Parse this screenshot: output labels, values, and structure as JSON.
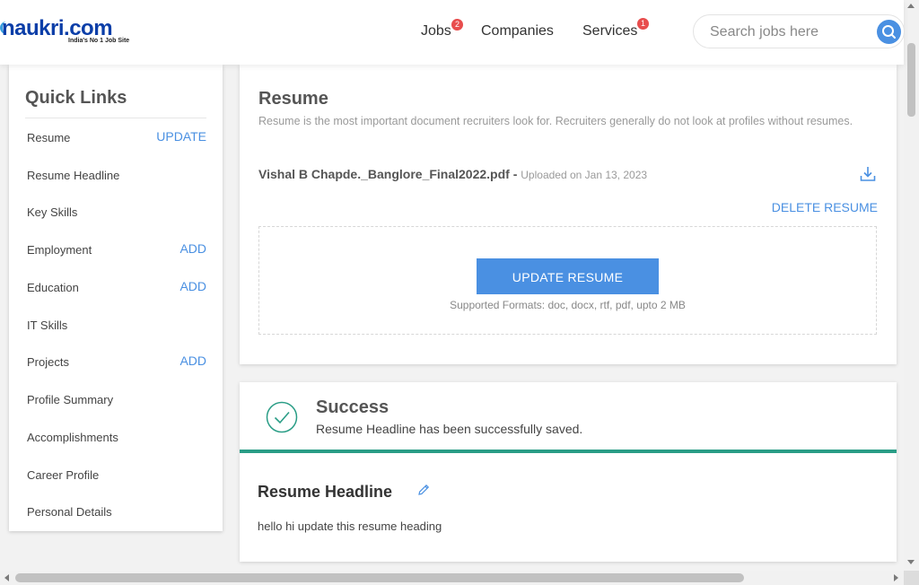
{
  "header": {
    "logo_text": "naukri.com",
    "logo_tagline": "India's No 1 Job Site",
    "nav": [
      {
        "label": "Jobs",
        "badge": "2"
      },
      {
        "label": "Companies",
        "badge": ""
      },
      {
        "label": "Services",
        "badge": "1"
      }
    ],
    "search_placeholder": "Search jobs here"
  },
  "sidebar": {
    "title": "Quick Links",
    "items": [
      {
        "label": "Resume",
        "action": "UPDATE"
      },
      {
        "label": "Resume Headline",
        "action": ""
      },
      {
        "label": "Key Skills",
        "action": ""
      },
      {
        "label": "Employment",
        "action": "ADD"
      },
      {
        "label": "Education",
        "action": "ADD"
      },
      {
        "label": "IT Skills",
        "action": ""
      },
      {
        "label": "Projects",
        "action": "ADD"
      },
      {
        "label": "Profile Summary",
        "action": ""
      },
      {
        "label": "Accomplishments",
        "action": ""
      },
      {
        "label": "Career Profile",
        "action": ""
      },
      {
        "label": "Personal Details",
        "action": ""
      }
    ]
  },
  "resume": {
    "title": "Resume",
    "description": "Resume is the most important document recruiters look for. Recruiters generally do not look at profiles without resumes.",
    "file_name": "Vishal B Chapde._Banglore_Final2022.pdf -",
    "uploaded": "Uploaded on Jan 13, 2023",
    "delete_label": "DELETE RESUME",
    "update_label": "UPDATE RESUME",
    "formats": "Supported Formats: doc, docx, rtf, pdf, upto 2 MB"
  },
  "success": {
    "title": "Success",
    "message": "Resume Headline has been successfully saved."
  },
  "headline": {
    "title": "Resume Headline",
    "text": "hello hi update this resume heading"
  },
  "colors": {
    "accent": "#4a90e2",
    "success": "#2a9d86",
    "badge": "#e84d4d"
  }
}
